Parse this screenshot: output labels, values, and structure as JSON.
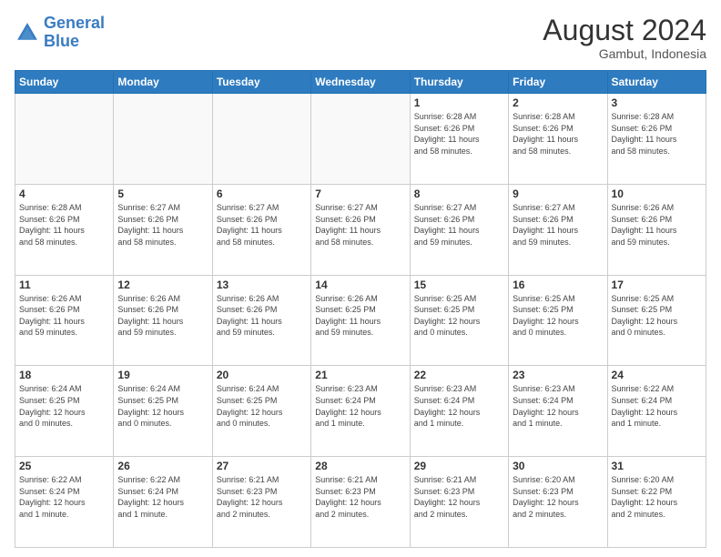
{
  "header": {
    "logo_general": "General",
    "logo_blue": "Blue",
    "month_title": "August 2024",
    "subtitle": "Gambut, Indonesia"
  },
  "days_of_week": [
    "Sunday",
    "Monday",
    "Tuesday",
    "Wednesday",
    "Thursday",
    "Friday",
    "Saturday"
  ],
  "weeks": [
    [
      {
        "day": "",
        "info": ""
      },
      {
        "day": "",
        "info": ""
      },
      {
        "day": "",
        "info": ""
      },
      {
        "day": "",
        "info": ""
      },
      {
        "day": "1",
        "info": "Sunrise: 6:28 AM\nSunset: 6:26 PM\nDaylight: 11 hours\nand 58 minutes."
      },
      {
        "day": "2",
        "info": "Sunrise: 6:28 AM\nSunset: 6:26 PM\nDaylight: 11 hours\nand 58 minutes."
      },
      {
        "day": "3",
        "info": "Sunrise: 6:28 AM\nSunset: 6:26 PM\nDaylight: 11 hours\nand 58 minutes."
      }
    ],
    [
      {
        "day": "4",
        "info": "Sunrise: 6:28 AM\nSunset: 6:26 PM\nDaylight: 11 hours\nand 58 minutes."
      },
      {
        "day": "5",
        "info": "Sunrise: 6:27 AM\nSunset: 6:26 PM\nDaylight: 11 hours\nand 58 minutes."
      },
      {
        "day": "6",
        "info": "Sunrise: 6:27 AM\nSunset: 6:26 PM\nDaylight: 11 hours\nand 58 minutes."
      },
      {
        "day": "7",
        "info": "Sunrise: 6:27 AM\nSunset: 6:26 PM\nDaylight: 11 hours\nand 58 minutes."
      },
      {
        "day": "8",
        "info": "Sunrise: 6:27 AM\nSunset: 6:26 PM\nDaylight: 11 hours\nand 59 minutes."
      },
      {
        "day": "9",
        "info": "Sunrise: 6:27 AM\nSunset: 6:26 PM\nDaylight: 11 hours\nand 59 minutes."
      },
      {
        "day": "10",
        "info": "Sunrise: 6:26 AM\nSunset: 6:26 PM\nDaylight: 11 hours\nand 59 minutes."
      }
    ],
    [
      {
        "day": "11",
        "info": "Sunrise: 6:26 AM\nSunset: 6:26 PM\nDaylight: 11 hours\nand 59 minutes."
      },
      {
        "day": "12",
        "info": "Sunrise: 6:26 AM\nSunset: 6:26 PM\nDaylight: 11 hours\nand 59 minutes."
      },
      {
        "day": "13",
        "info": "Sunrise: 6:26 AM\nSunset: 6:26 PM\nDaylight: 11 hours\nand 59 minutes."
      },
      {
        "day": "14",
        "info": "Sunrise: 6:26 AM\nSunset: 6:25 PM\nDaylight: 11 hours\nand 59 minutes."
      },
      {
        "day": "15",
        "info": "Sunrise: 6:25 AM\nSunset: 6:25 PM\nDaylight: 12 hours\nand 0 minutes."
      },
      {
        "day": "16",
        "info": "Sunrise: 6:25 AM\nSunset: 6:25 PM\nDaylight: 12 hours\nand 0 minutes."
      },
      {
        "day": "17",
        "info": "Sunrise: 6:25 AM\nSunset: 6:25 PM\nDaylight: 12 hours\nand 0 minutes."
      }
    ],
    [
      {
        "day": "18",
        "info": "Sunrise: 6:24 AM\nSunset: 6:25 PM\nDaylight: 12 hours\nand 0 minutes."
      },
      {
        "day": "19",
        "info": "Sunrise: 6:24 AM\nSunset: 6:25 PM\nDaylight: 12 hours\nand 0 minutes."
      },
      {
        "day": "20",
        "info": "Sunrise: 6:24 AM\nSunset: 6:25 PM\nDaylight: 12 hours\nand 0 minutes."
      },
      {
        "day": "21",
        "info": "Sunrise: 6:23 AM\nSunset: 6:24 PM\nDaylight: 12 hours\nand 1 minute."
      },
      {
        "day": "22",
        "info": "Sunrise: 6:23 AM\nSunset: 6:24 PM\nDaylight: 12 hours\nand 1 minute."
      },
      {
        "day": "23",
        "info": "Sunrise: 6:23 AM\nSunset: 6:24 PM\nDaylight: 12 hours\nand 1 minute."
      },
      {
        "day": "24",
        "info": "Sunrise: 6:22 AM\nSunset: 6:24 PM\nDaylight: 12 hours\nand 1 minute."
      }
    ],
    [
      {
        "day": "25",
        "info": "Sunrise: 6:22 AM\nSunset: 6:24 PM\nDaylight: 12 hours\nand 1 minute."
      },
      {
        "day": "26",
        "info": "Sunrise: 6:22 AM\nSunset: 6:24 PM\nDaylight: 12 hours\nand 1 minute."
      },
      {
        "day": "27",
        "info": "Sunrise: 6:21 AM\nSunset: 6:23 PM\nDaylight: 12 hours\nand 2 minutes."
      },
      {
        "day": "28",
        "info": "Sunrise: 6:21 AM\nSunset: 6:23 PM\nDaylight: 12 hours\nand 2 minutes."
      },
      {
        "day": "29",
        "info": "Sunrise: 6:21 AM\nSunset: 6:23 PM\nDaylight: 12 hours\nand 2 minutes."
      },
      {
        "day": "30",
        "info": "Sunrise: 6:20 AM\nSunset: 6:23 PM\nDaylight: 12 hours\nand 2 minutes."
      },
      {
        "day": "31",
        "info": "Sunrise: 6:20 AM\nSunset: 6:22 PM\nDaylight: 12 hours\nand 2 minutes."
      }
    ]
  ]
}
